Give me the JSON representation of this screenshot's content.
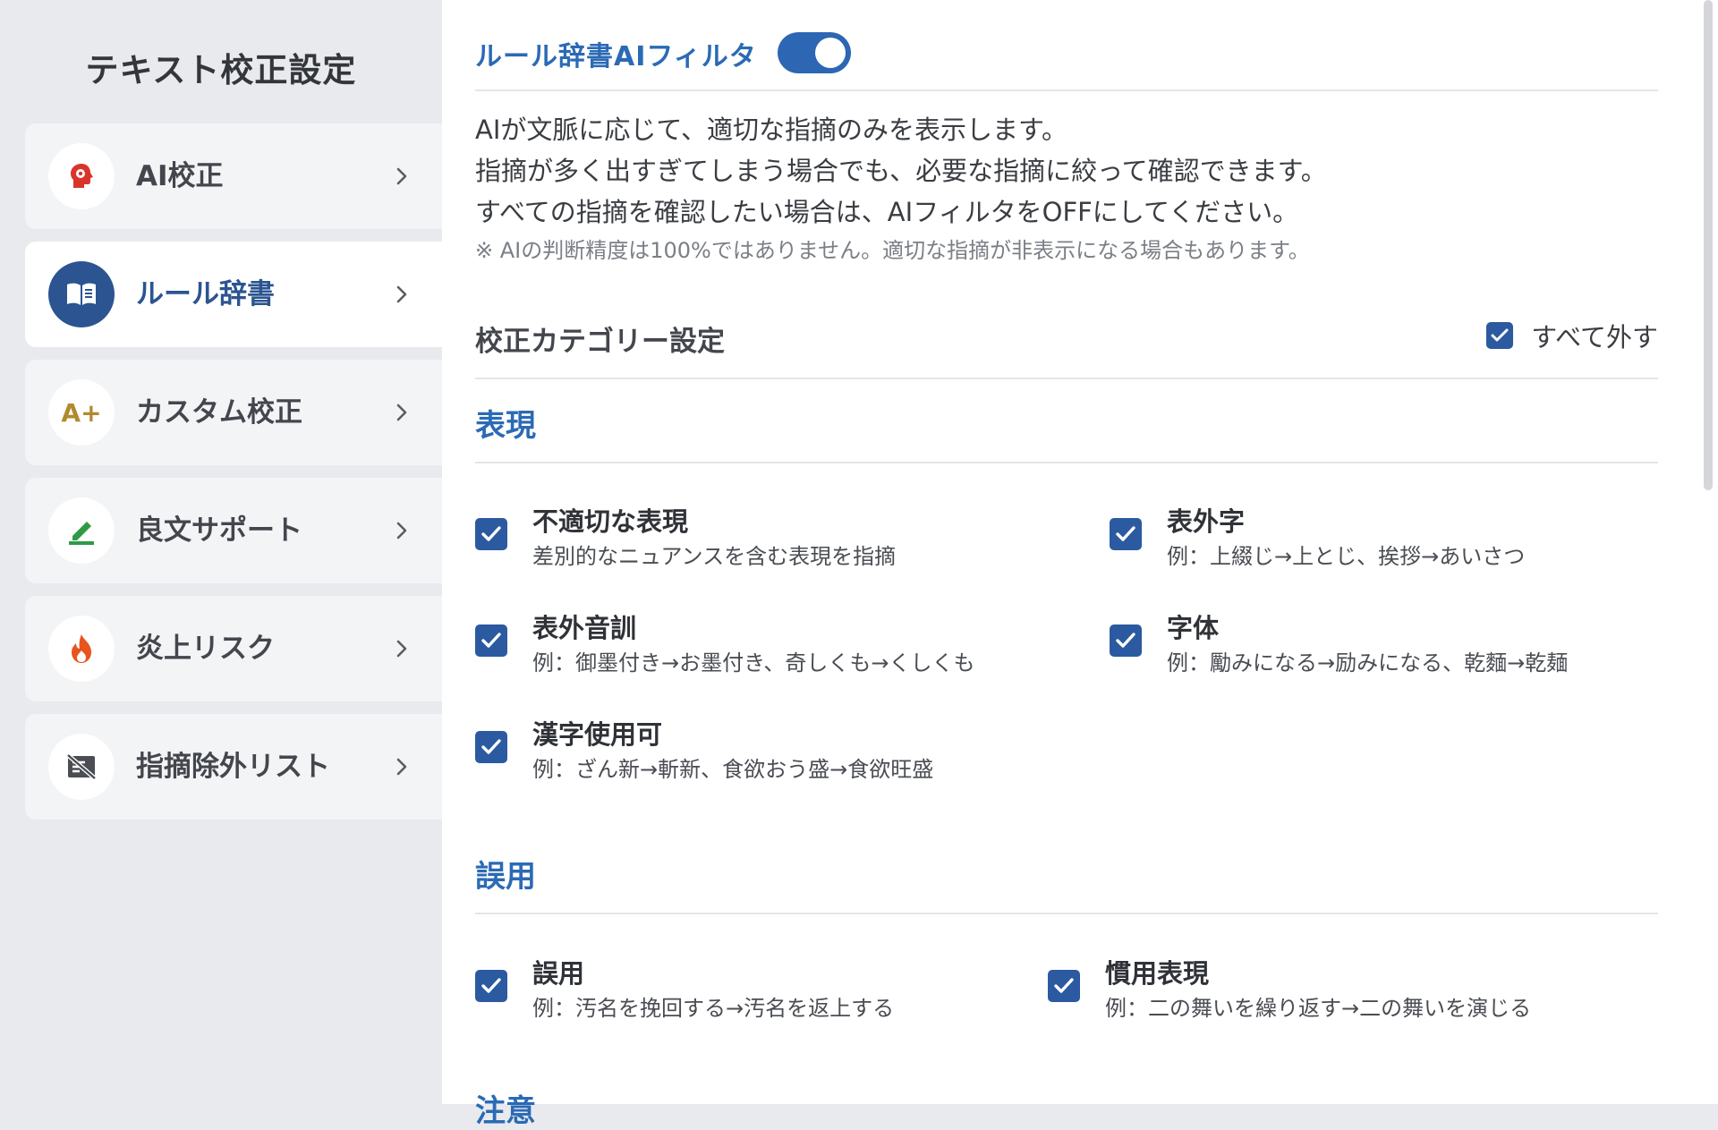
{
  "sidebar": {
    "title": "テキスト校正設定",
    "items": [
      {
        "label": "AI校正",
        "icon": "ai-head-icon"
      },
      {
        "label": "ルール辞書",
        "icon": "book-icon"
      },
      {
        "label": "カスタム校正",
        "icon": "a-plus-icon",
        "icon_text": "A+"
      },
      {
        "label": "良文サポート",
        "icon": "pencil-icon"
      },
      {
        "label": "炎上リスク",
        "icon": "flame-icon"
      },
      {
        "label": "指摘除外リスト",
        "icon": "excluded-list-icon"
      }
    ],
    "active_index": 1
  },
  "main": {
    "filter_title": "ルール辞書AIフィルタ",
    "filter_toggle_on": true,
    "description": [
      "AIが文脈に応じて、適切な指摘のみを表示します。",
      "指摘が多く出すぎてしまう場合でも、必要な指摘に絞って確認できます。",
      "すべての指摘を確認したい場合は、AIフィルタをOFFにしてください。"
    ],
    "note": "※ AIの判断精度は100%ではありません。適切な指摘が非表示になる場合もあります。",
    "category_title": "校正カテゴリー設定",
    "uncheck_all_label": "すべて外す",
    "sections": [
      {
        "title": "表現",
        "items": [
          {
            "label": "不適切な表現",
            "desc": "差別的なニュアンスを含む表現を指摘",
            "checked": true
          },
          {
            "label": "表外字",
            "desc": "例：上綴じ→上とじ、挨拶→あいさつ",
            "checked": true
          },
          {
            "label": "表外音訓",
            "desc": "例：御墨付き→お墨付き、奇しくも→くしくも",
            "checked": true
          },
          {
            "label": "字体",
            "desc": "例：勵みになる→励みになる、乾麵→乾麺",
            "checked": true
          },
          {
            "label": "漢字使用可",
            "desc": "例：ざん新→斬新、食欲おう盛→食欲旺盛",
            "checked": true
          }
        ]
      },
      {
        "title": "誤用",
        "items": [
          {
            "label": "誤用",
            "desc": "例：汚名を挽回する→汚名を返上する",
            "checked": true
          },
          {
            "label": "慣用表現",
            "desc": "例：二の舞いを繰り返す→二の舞いを演じる",
            "checked": true
          }
        ]
      },
      {
        "title": "注意"
      }
    ]
  },
  "colors": {
    "accent": "#2b5aa0",
    "accent_text": "#2b6ab5",
    "sidebar_bg": "#e8eaed",
    "item_bg": "#f3f4f6",
    "ai_icon": "#d9342b",
    "a_plus_icon": "#b08a2e",
    "pencil_icon": "#2f9a46",
    "flame_icon": "#e8541e"
  }
}
